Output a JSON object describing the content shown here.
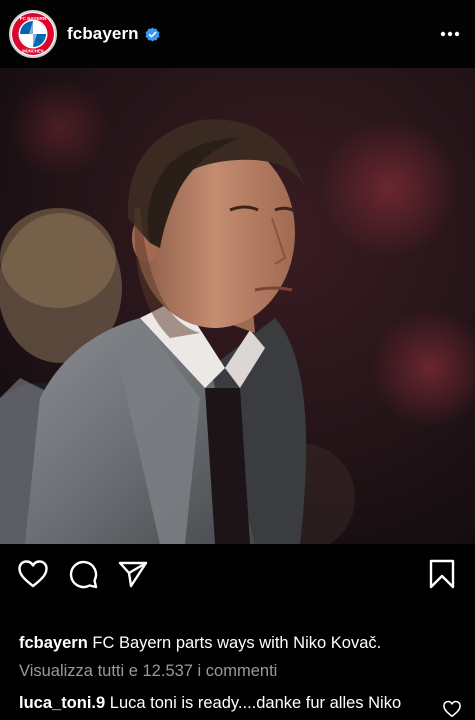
{
  "header": {
    "username": "fcbayern",
    "verified": true,
    "avatar_icon": "fc-bayern-logo-icon",
    "avatar_text_top": "FC BAYERN",
    "avatar_text_bottom": "MÜNCHEN",
    "more_icon": "more-options-icon"
  },
  "photo": {
    "subject": "coach-portrait-photo"
  },
  "actions": {
    "like_icon": "heart-icon",
    "comment_icon": "comment-icon",
    "share_icon": "send-icon",
    "save_icon": "bookmark-icon"
  },
  "caption": {
    "username": "fcbayern",
    "text": "FC Bayern parts ways with Niko Kovač."
  },
  "view_comments": "Visualizza tutti e 12.537 i commenti",
  "comment": {
    "username": "luca_toni.9",
    "text": "Luca toni is ready....danke fur alles Niko",
    "like_icon": "heart-icon"
  },
  "colors": {
    "background": "#000000",
    "text": "#ffffff",
    "secondary_text": "#9a9a9a",
    "verified_blue": "#3897f0",
    "bayern_red": "#dc052d",
    "bayern_blue": "#0066b2"
  }
}
